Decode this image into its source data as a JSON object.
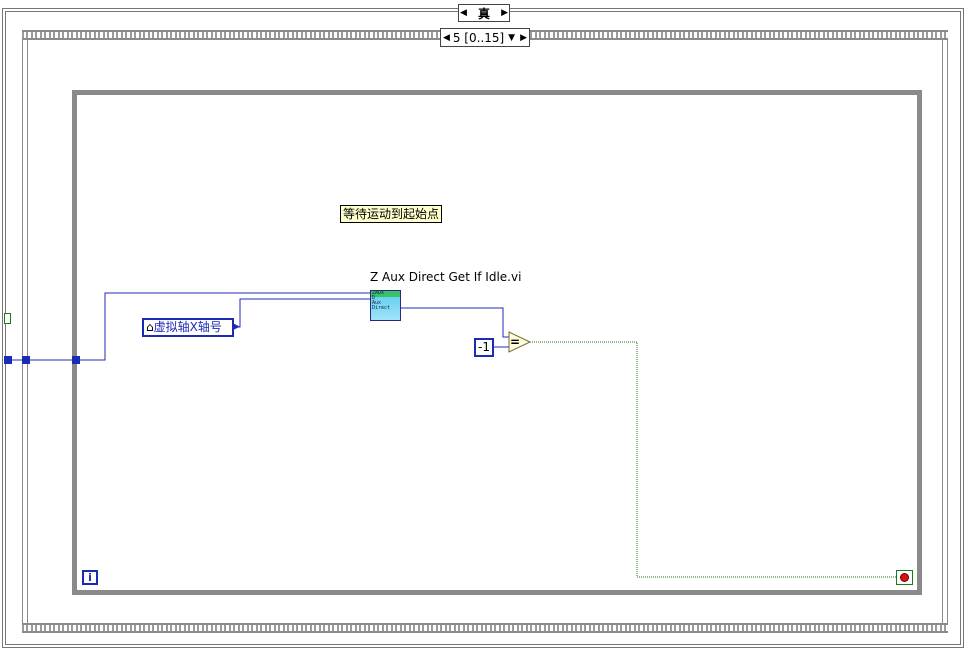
{
  "case_structure": {
    "selector_value": "真",
    "prev_arrow": "◀",
    "next_arrow": "▶"
  },
  "sequence_structure": {
    "selector_value": "5 [0..15]",
    "prev_arrow": "◀",
    "dropdown_arrow": "▼",
    "next_arrow": "▶"
  },
  "comment": {
    "text": "等待运动到起始点"
  },
  "subvi": {
    "label": "Z Aux Direct Get If Idle.vi",
    "icon_lines": [
      "ZAUX",
      "D",
      "Aux",
      "Direct"
    ]
  },
  "global_variable": {
    "icon": "house-icon",
    "icon_glyph": "⌂",
    "name": "虚拟轴X轴号"
  },
  "constant": {
    "value": "-1"
  },
  "equal_function": {
    "symbol": "="
  },
  "while_loop": {
    "iteration_terminal": "i",
    "stop_terminal": "stop-if-true-icon"
  },
  "colors": {
    "wire_integer": "#1c2bb5",
    "wire_boolean": "#1a7a1a",
    "structure_border": "#8a8a8a",
    "comment_bg": "#ffffcc"
  }
}
